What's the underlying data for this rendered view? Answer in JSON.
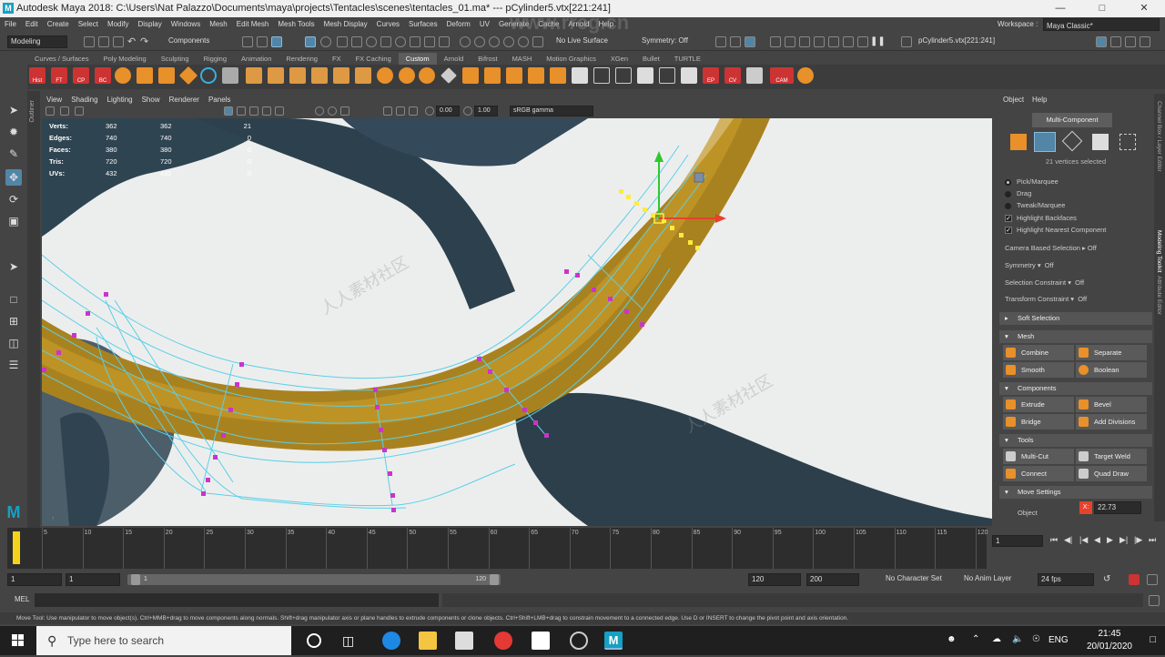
{
  "window": {
    "title": "Autodesk Maya 2018: C:\\Users\\Nat Palazzo\\Documents\\maya\\projects\\Tentacles\\scenes\\tentacles_01.ma*   ---   pCylinder5.vtx[221:241]",
    "logo": "M",
    "minimize_icon": "minimize-icon",
    "maximize_icon": "maximize-icon",
    "close_icon": "close-icon"
  },
  "menu": [
    "File",
    "Edit",
    "Create",
    "Select",
    "Modify",
    "Display",
    "Windows",
    "Mesh",
    "Edit Mesh",
    "Mesh Tools",
    "Mesh Display",
    "Curves",
    "Surfaces",
    "Deform",
    "UV",
    "Generate",
    "Cache",
    "Arnold",
    "Help"
  ],
  "workspace": {
    "label": "Workspace :",
    "value": "Maya Classic*"
  },
  "statusline": {
    "menuset": "Modeling",
    "select_mode": "Components",
    "live_surface": "No Live Surface",
    "symmetry": "Symmetry: Off",
    "selection_field": "pCylinder5.vtx[221:241]"
  },
  "shelf_tabs": [
    "Curves / Surfaces",
    "Poly Modeling",
    "Sculpting",
    "Rigging",
    "Animation",
    "Rendering",
    "FX",
    "FX Caching",
    "Custom",
    "Arnold",
    "Bifrost",
    "MASH",
    "Motion Graphics",
    "XGen",
    "Bullet",
    "TURTLE"
  ],
  "shelf_active": "Custom",
  "shelf_labels": [
    "Hist",
    "FT",
    "CP",
    "BC",
    "EP",
    "CV",
    "CAM"
  ],
  "viewport": {
    "menu": [
      "View",
      "Shading",
      "Lighting",
      "Show",
      "Renderer",
      "Panels"
    ],
    "exposure": "0.00",
    "gamma": "1.00",
    "colorspace": "sRGB gamma",
    "hud": [
      {
        "label": "Verts:",
        "a": "362",
        "b": "362",
        "c": "21"
      },
      {
        "label": "Edges:",
        "a": "740",
        "b": "740",
        "c": "0"
      },
      {
        "label": "Faces:",
        "a": "380",
        "b": "380",
        "c": "0"
      },
      {
        "label": "Tris:",
        "a": "720",
        "b": "720",
        "c": "0"
      },
      {
        "label": "UVs:",
        "a": "432",
        "b": "432",
        "c": "0"
      }
    ],
    "outliner_label": "Outliner"
  },
  "modeling_toolkit": {
    "menu": [
      "Object",
      "Help"
    ],
    "mode": "Multi-Component",
    "selection_info": "21 vertices selected",
    "pick_options": [
      {
        "label": "Pick/Marquee",
        "on": true
      },
      {
        "label": "Drag",
        "on": false
      },
      {
        "label": "Tweak/Marquee",
        "on": false
      }
    ],
    "checks": [
      {
        "label": "Highlight Backfaces",
        "on": true
      },
      {
        "label": "Highlight Nearest Component",
        "on": true
      }
    ],
    "camera_based": {
      "label": "Camera Based Selection",
      "value": "Off"
    },
    "symmetry": {
      "label": "Symmetry",
      "value": "Off"
    },
    "selection_constraint": {
      "label": "Selection Constraint",
      "value": "Off"
    },
    "transform_constraint": {
      "label": "Transform Constraint",
      "value": "Off"
    },
    "soft_selection": "Soft Selection",
    "mesh_section": "Mesh",
    "mesh_buttons": [
      "Combine",
      "Separate",
      "Smooth",
      "Boolean"
    ],
    "components_section": "Components",
    "component_buttons": [
      "Extrude",
      "Bevel",
      "Bridge",
      "Add Divisions"
    ],
    "tools_section": "Tools",
    "tool_buttons": [
      "Multi-Cut",
      "Target Weld",
      "Connect",
      "Quad Draw"
    ],
    "move_settings": "Move Settings",
    "object_label": "Object",
    "x_value": "22.73",
    "right_strip": [
      "Channel Box / Layer Editor",
      "Modeling Toolkit",
      "Attribute Editor"
    ]
  },
  "timeline": {
    "ticks": [
      "5",
      "10",
      "15",
      "20",
      "25",
      "30",
      "35",
      "40",
      "45",
      "50",
      "55",
      "60",
      "65",
      "70",
      "75",
      "80",
      "85",
      "90",
      "95",
      "100",
      "105",
      "110",
      "115",
      "120"
    ],
    "current_frame": "1"
  },
  "range": {
    "start": "1",
    "playback_start": "1",
    "slider_start": "1",
    "slider_end": "120",
    "playback_end": "120",
    "end": "200",
    "character_set": "No Character Set",
    "anim_layer": "No Anim Layer",
    "fps": "24 fps"
  },
  "cmdline": {
    "label": "MEL"
  },
  "helpline": "Move Tool: Use manipulator to move object(s). Ctrl+MMB+drag to move components along normals. Shift+drag manipulator axis or plane handles to extrude components or clone objects. Ctrl+Shift+LMB+drag to constrain movement to a connected edge. Use D or INSERT to change the pivot point and axis orientation.",
  "taskbar": {
    "search_placeholder": "Type here to search",
    "lang": "ENG",
    "time": "21:45",
    "date": "20/01/2020"
  },
  "watermark": "www.rrcg.cn",
  "watermark_cn": "人人素材社区",
  "colors": {
    "accent": "#5285a6",
    "selected_vertex": "#ffeb3b",
    "unselected_vertex": "#cc33cc",
    "wireframe": "#5ccfe6",
    "tentacle": "#b38a1d"
  }
}
